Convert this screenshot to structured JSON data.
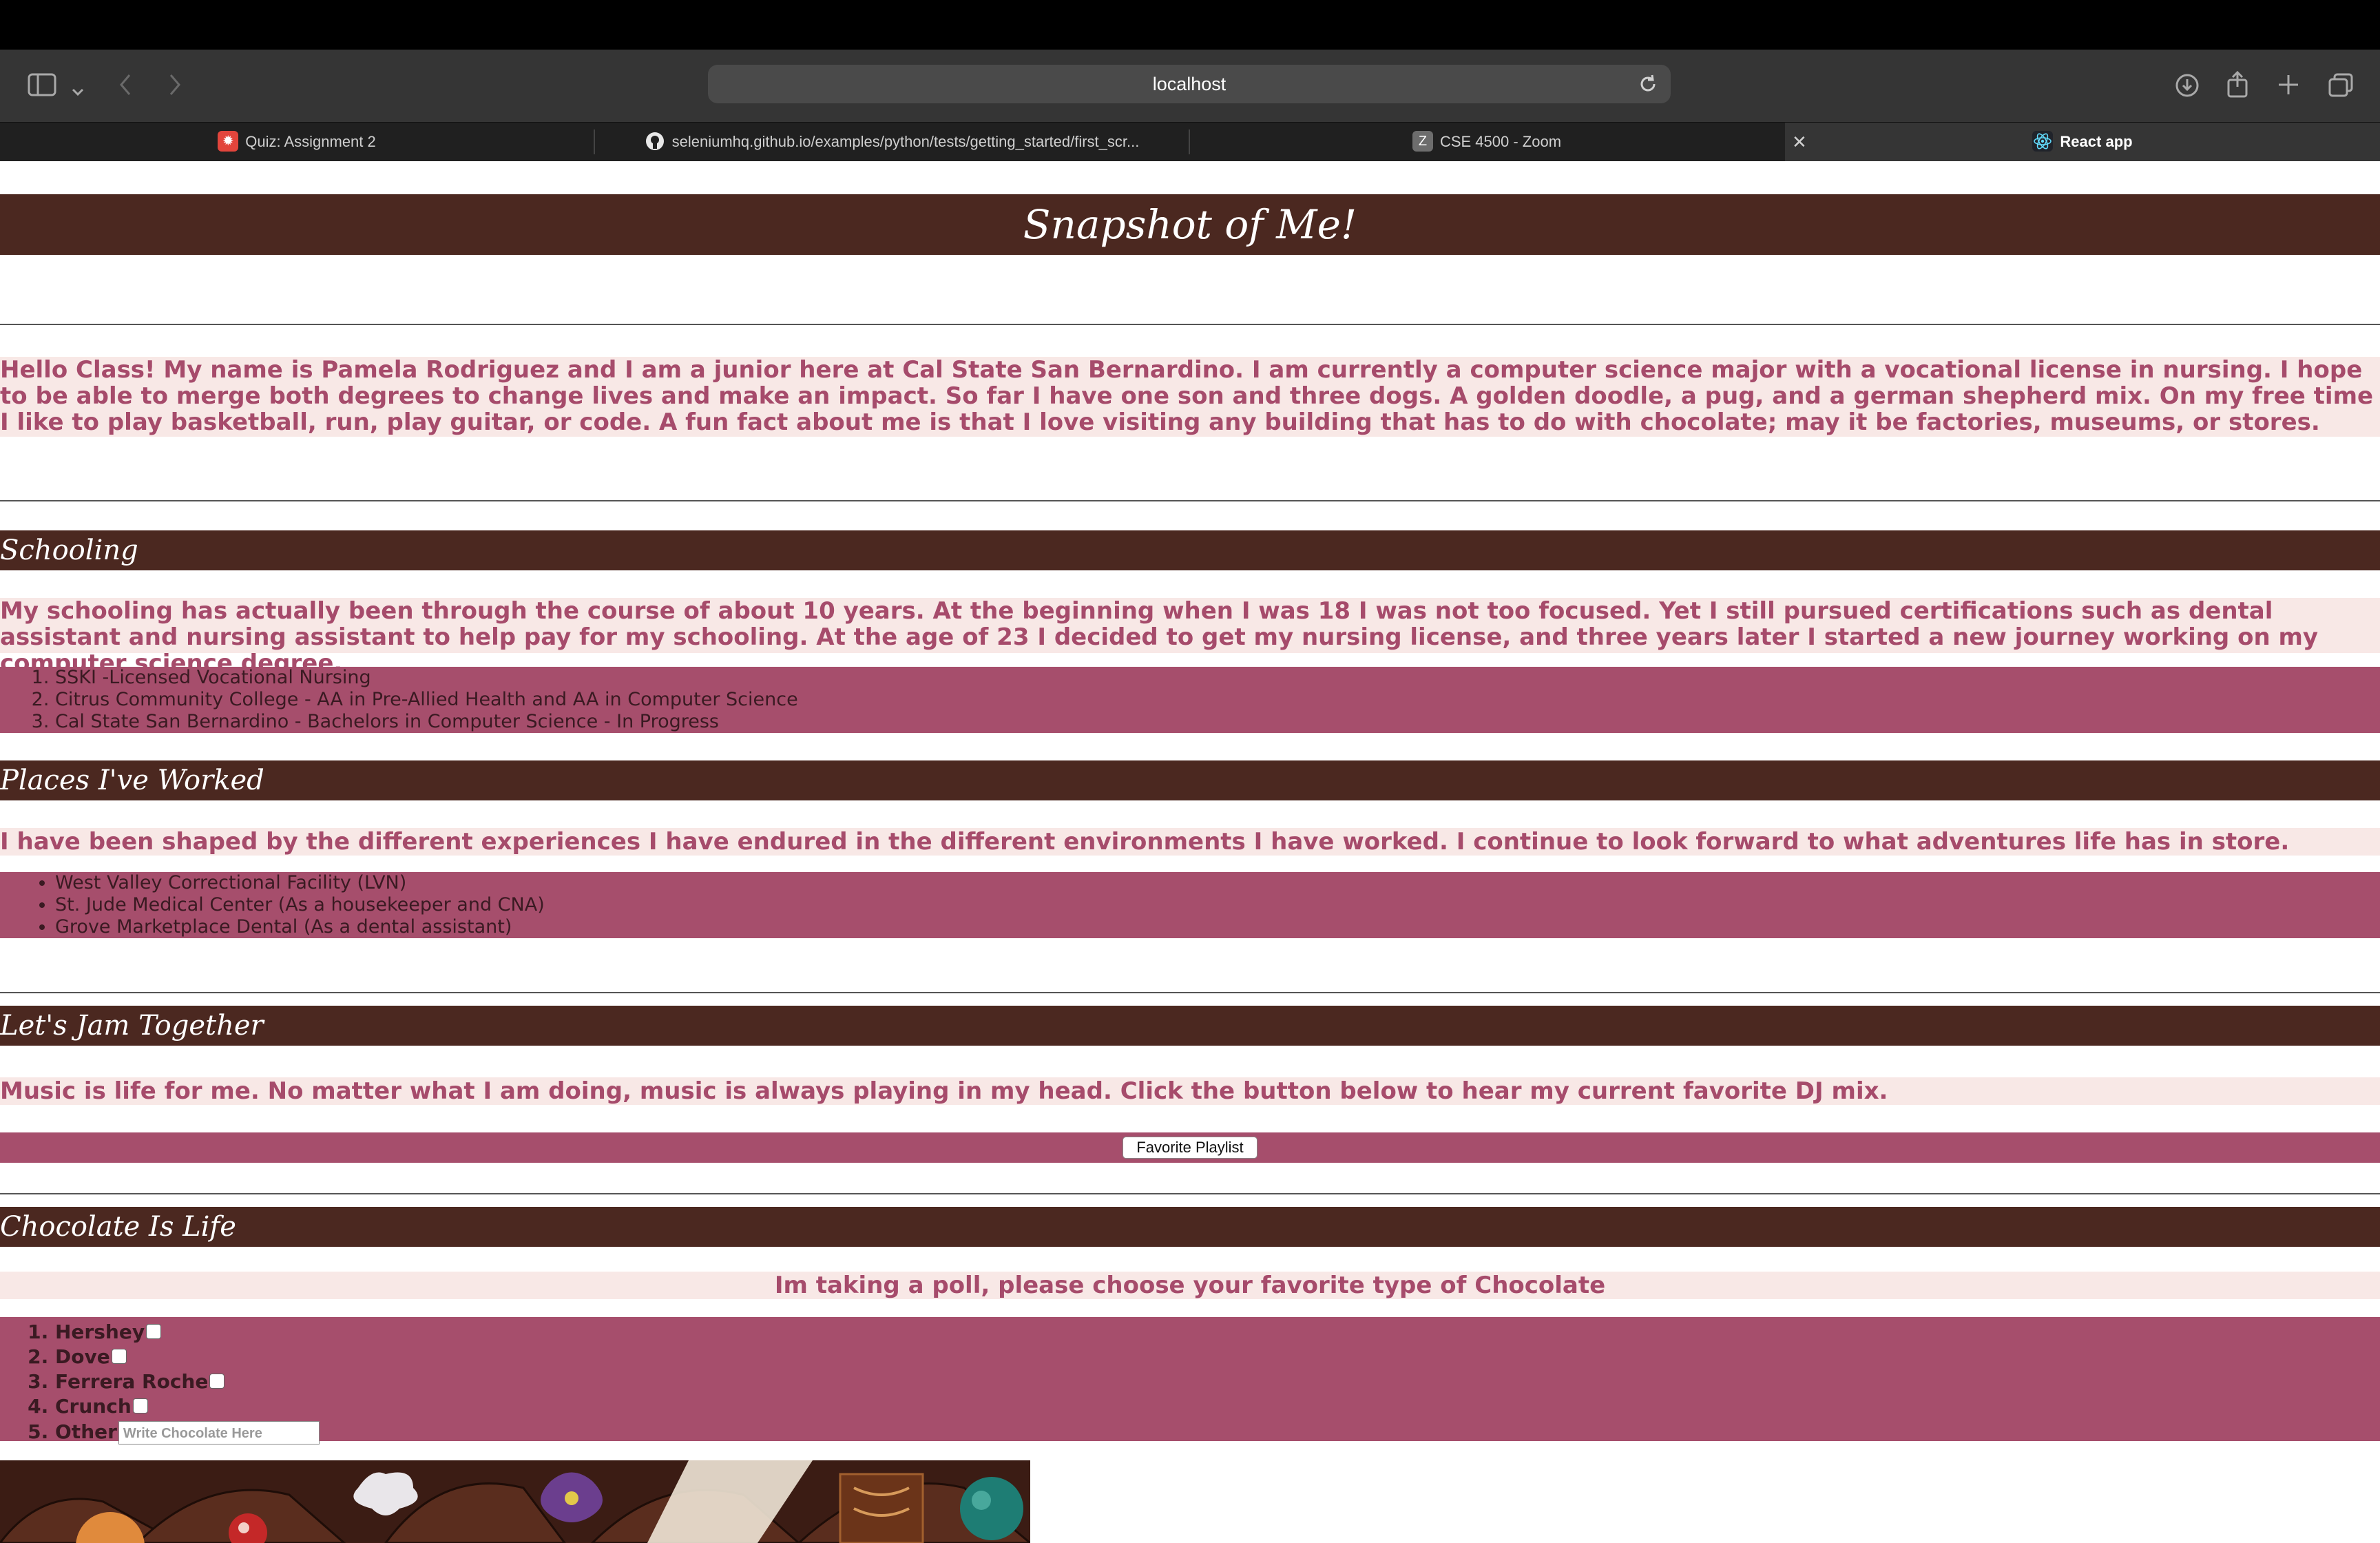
{
  "browser": {
    "url": "localhost",
    "tabs": [
      {
        "label": "Quiz: Assignment 2",
        "icon": "canvas-icon"
      },
      {
        "label": "seleniumhq.github.io/examples/python/tests/getting_started/first_scr...",
        "icon": "github-icon"
      },
      {
        "label": "CSE 4500 - Zoom",
        "icon": "zoom-icon"
      },
      {
        "label": "React app",
        "icon": "react-icon",
        "active": true
      }
    ]
  },
  "page": {
    "title": "Snapshot of Me!",
    "intro": "Hello Class! My name is Pamela Rodriguez and I am a junior here at Cal State San Bernardino. I am currently a computer science major with a vocational license in nursing. I hope to be able to merge both degrees to change lives and make an impact. So far I have one son and three dogs. A golden doodle, a pug, and a german shepherd mix. On my free time I like to play basketball, run, play guitar, or code. A fun fact about me is that I love visiting any building that has to do with chocolate; may it be factories, museums, or stores.",
    "schooling": {
      "heading": "Schooling",
      "text": "My schooling has actually been through the course of about 10 years. At the beginning when I was 18 I was not too focused. Yet I still pursued certifications such as dental assistant and nursing assistant to help pay for my schooling. At the age of 23 I decided to get my nursing license, and three years later I started a new journey working on my computer science degree.",
      "items": [
        "SSKI -Licensed Vocational Nursing",
        "Citrus Community College - AA in Pre-Allied Health and AA in Computer Science",
        "Cal State San Bernardino - Bachelors in Computer Science - In Progress"
      ]
    },
    "work": {
      "heading": "Places I've Worked",
      "text": "I have been shaped by the different experiences I have endured in the different environments I have worked. I continue to look forward to what adventures life has in store.",
      "items": [
        "West Valley Correctional Facility (LVN)",
        "St. Jude Medical Center (As a housekeeper and CNA)",
        "Grove Marketplace Dental (As a dental assistant)"
      ]
    },
    "jam": {
      "heading": "Let's Jam Together",
      "text": "Music is life for me. No matter what I am doing, music is always playing in my head. Click the button below to hear my current favorite DJ mix.",
      "button": "Favorite Playlist"
    },
    "chocolate": {
      "heading": "Chocolate Is Life",
      "poll": "Im taking a poll, please choose your favorite type of Chocolate",
      "options": [
        "Hershey",
        "Dove",
        "Ferrera Roche",
        "Crunch"
      ],
      "other_label": "Other",
      "other_placeholder": "Write Chocolate Here"
    }
  }
}
